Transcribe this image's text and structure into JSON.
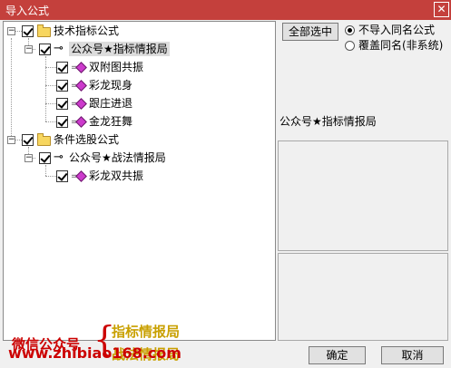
{
  "window": {
    "title": "导入公式",
    "close_glyph": "✕"
  },
  "tree": {
    "groups": [
      {
        "label": "技术指标公式",
        "expander": "−",
        "checked": true,
        "children": [
          {
            "label": "公众号★指标情报局",
            "expander": "−",
            "checked": true,
            "selected": true,
            "items": [
              "双附图共振",
              "彩龙现身",
              "跟庄进退",
              "金龙狂舞"
            ]
          }
        ]
      },
      {
        "label": "条件选股公式",
        "expander": "−",
        "checked": true,
        "children": [
          {
            "label": "公众号★战法情报局",
            "expander": "−",
            "checked": true,
            "items": [
              "彩龙双共振"
            ]
          }
        ]
      }
    ]
  },
  "controls": {
    "select_all_label": "全部选中",
    "radio_options": [
      {
        "label": "不导入同名公式",
        "selected": true
      },
      {
        "label": "覆盖同名(非系统)",
        "selected": false
      }
    ],
    "info_label": "公众号★指标情报局",
    "ok_label": "确定",
    "cancel_label": "取消"
  },
  "watermark": {
    "left_text": "微信公众号",
    "brace": "{",
    "line1": "指标情报局",
    "line2": "战法情报局",
    "url": "www.zhibiao168.com",
    "colors": {
      "red": "#cc0000",
      "gold": "#c9a000"
    }
  },
  "colors": {
    "titlebar": "#c4403c",
    "diamond": "#cc3acc",
    "folder": "#f7d65f"
  }
}
